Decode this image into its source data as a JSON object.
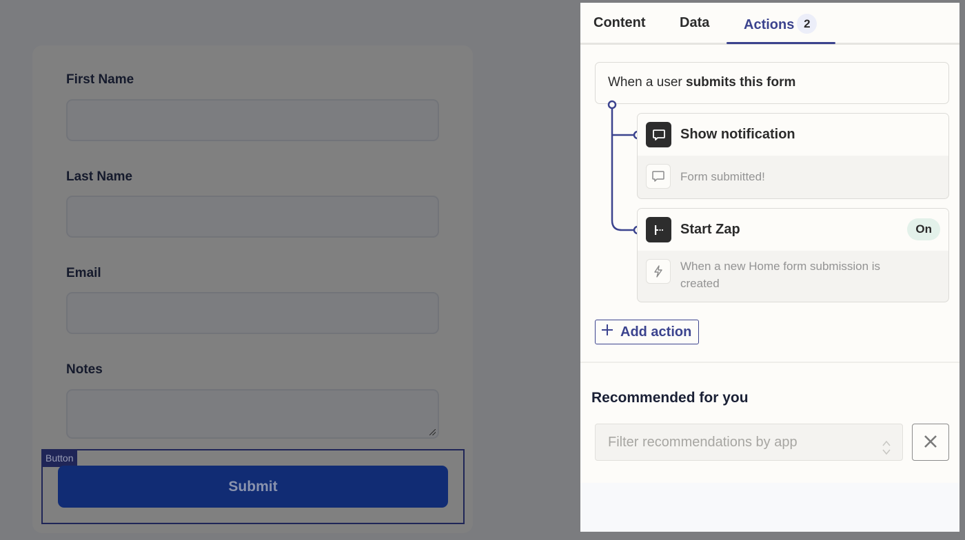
{
  "form": {
    "fields": [
      {
        "label": "First Name",
        "value": "",
        "type": "text"
      },
      {
        "label": "Last Name",
        "value": "",
        "type": "text"
      },
      {
        "label": "Email",
        "value": "",
        "type": "text"
      },
      {
        "label": "Notes",
        "value": "",
        "type": "textarea"
      }
    ],
    "selection_tag": "Button",
    "submit_label": "Submit"
  },
  "panel": {
    "tabs": [
      {
        "label": "Content",
        "active": false
      },
      {
        "label": "Data",
        "active": false
      },
      {
        "label": "Actions",
        "active": true,
        "badge": "2"
      }
    ],
    "trigger": {
      "prefix": "When a user ",
      "emphasis": "submits this form"
    },
    "actions": [
      {
        "title": "Show notification",
        "icon": "chat-bubble-icon",
        "detail_icon": "chat-bubble-icon",
        "detail": "Form submitted!"
      },
      {
        "title": "Start Zap",
        "icon": "zap-step-icon",
        "status": "On",
        "detail_icon": "lightning-icon",
        "detail": "When a new Home form submission is created"
      }
    ],
    "add_action_label": "Add action",
    "recommended": {
      "title": "Recommended for you",
      "filter_placeholder": "Filter recommendations by app"
    }
  },
  "colors": {
    "accent": "#3b438e",
    "submit_button": "#112c74",
    "status_on_bg": "#e3f1ea",
    "panel_bg": "#fdfcf9",
    "overlay": "#7b7c7f"
  }
}
